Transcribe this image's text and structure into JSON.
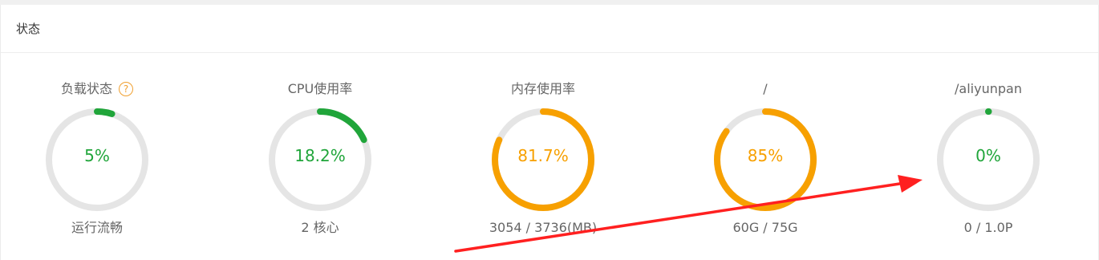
{
  "panel": {
    "title": "状态"
  },
  "colors": {
    "green": "#20a53a",
    "orange": "#f7a000",
    "track": "#e5e5e5",
    "help": "#f0a030",
    "arrow": "#ff2020"
  },
  "gauges": [
    {
      "label": "负载状态",
      "value_text": "5%",
      "fraction": 0.05,
      "sub": "运行流畅",
      "color": "#20a53a",
      "has_help": true,
      "help_glyph": "?"
    },
    {
      "label": "CPU使用率",
      "value_text": "18.2%",
      "fraction": 0.182,
      "sub": "2 核心",
      "color": "#20a53a",
      "has_help": false
    },
    {
      "label": "内存使用率",
      "value_text": "81.7%",
      "fraction": 0.817,
      "sub": "3054 / 3736(MB)",
      "color": "#f7a000",
      "has_help": false
    },
    {
      "label": "/",
      "value_text": "85%",
      "fraction": 0.85,
      "sub": "60G / 75G",
      "color": "#f7a000",
      "has_help": false
    },
    {
      "label": "/aliyunpan",
      "value_text": "0%",
      "fraction": 0.0,
      "sub": "0 / 1.0P",
      "color": "#20a53a",
      "has_help": false
    }
  ]
}
